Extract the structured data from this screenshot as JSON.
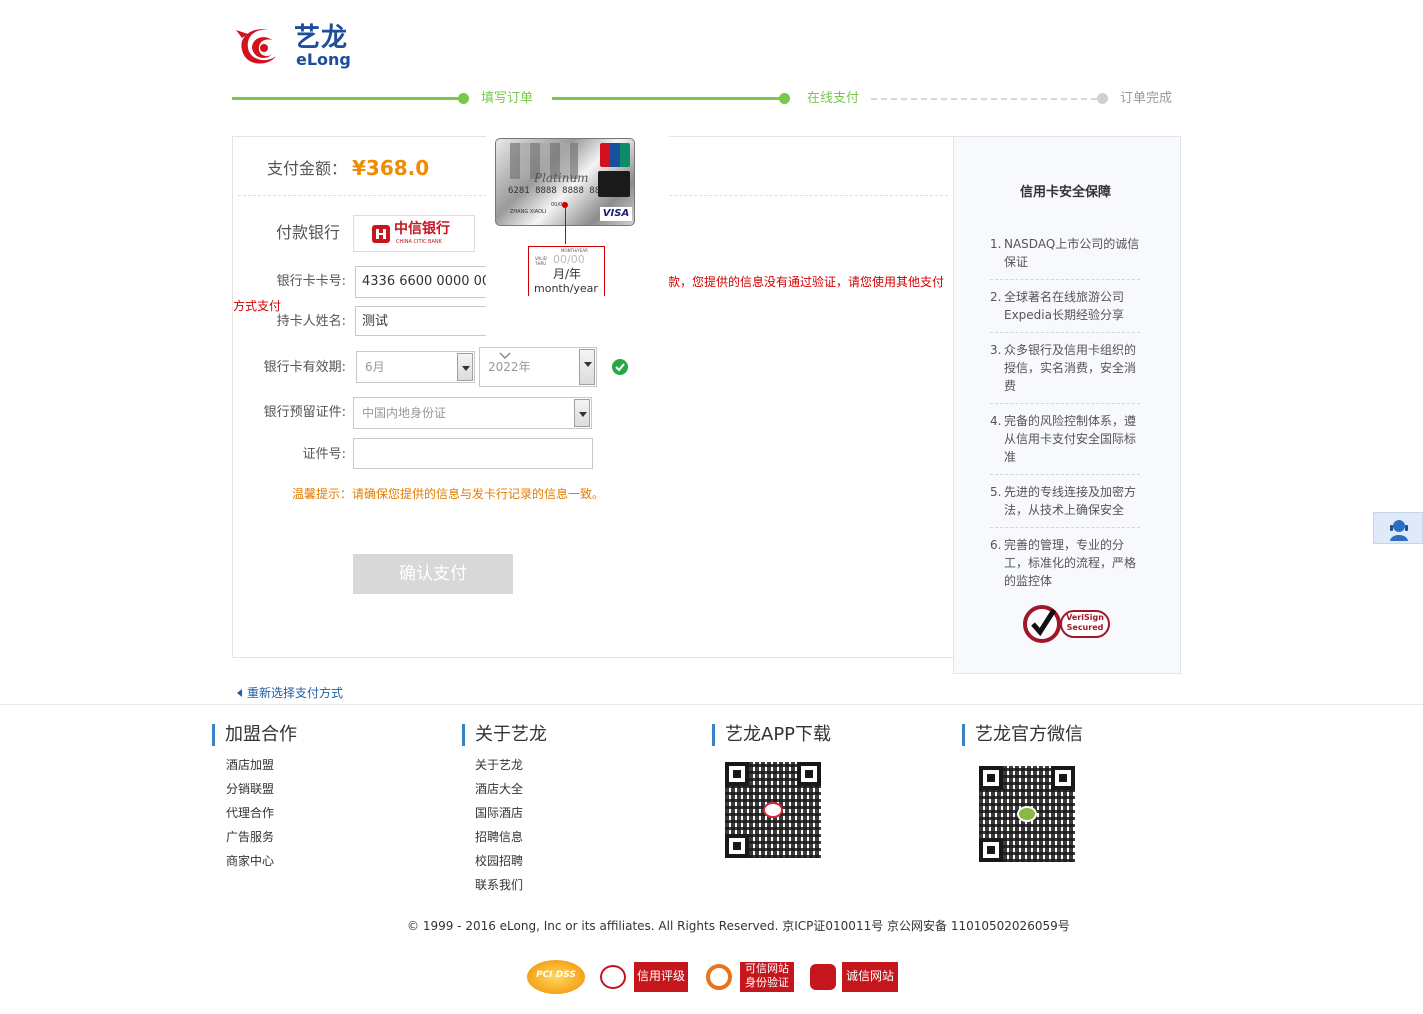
{
  "logo": {
    "cn": "艺龙",
    "en": "eLong"
  },
  "steps": [
    {
      "label": "填写订单",
      "state": "done"
    },
    {
      "label": "在线支付",
      "state": "current"
    },
    {
      "label": "订单完成",
      "state": "todo"
    }
  ],
  "payment": {
    "amount_label": "支付金额：",
    "amount": "¥368.0",
    "bank_label": "付款银行",
    "bank_name": "中信银行",
    "bank_name_en": "CHINA CITIC BANK",
    "card_no_label": "银行卡卡号:",
    "card_no_value": "4336 6600 0000 000",
    "error_text": "款，您提供的信息没有通过验证，请您使用其他支付",
    "error_text_wrap": "方式支付",
    "holder_label": "持卡人姓名:",
    "holder_value": "测试",
    "expiry_label": "银行卡有效期:",
    "month_value": "6月",
    "year_value": "2022年",
    "id_type_label": "银行预留证件:",
    "id_type_value": "中国内地身份证",
    "id_no_label": "证件号:",
    "id_no_value": "",
    "tip": "温馨提示：请确保您提供的信息与发卡行记录的信息一致。",
    "submit_label": "确认支付"
  },
  "card_tooltip": {
    "card_number": "6281 8888 8888 8888",
    "card_brand": "Platinum",
    "valid_thru": "00/00",
    "valid_caption": "VALID THRU",
    "month_year_header": "MONTH/YEAR",
    "month_year_cn": "月/年",
    "month_year_en": "month/year",
    "name": "ZHANG XIAOLI",
    "network": "VISA",
    "unionpay": "UnionPay 银联"
  },
  "security": {
    "title": "信用卡安全保障",
    "items": [
      "NASDAQ上市公司的诚信保证",
      "全球著名在线旅游公司Expedia长期经验分享",
      "众多银行及信用卡组织的授信，实名消费，安全消费",
      "完备的风险控制体系，遵从信用卡支付安全国际标准",
      "先进的专线连接及加密方法，从技术上确保安全",
      "完善的管理，专业的分工，标准化的流程，严格的监控体"
    ],
    "verisign_line1": "VeriSign",
    "verisign_line2": "Secured"
  },
  "back_link": "重新选择支付方式",
  "footer": {
    "columns": [
      {
        "title": "加盟合作",
        "links": [
          "酒店加盟",
          "分销联盟",
          "代理合作",
          "广告服务",
          "商家中心"
        ]
      },
      {
        "title": "关于艺龙",
        "links": [
          "关于艺龙",
          "酒店大全",
          "国际酒店",
          "招聘信息",
          "校园招聘",
          "联系我们"
        ]
      },
      {
        "title": "艺龙APP下载"
      },
      {
        "title": "艺龙官方微信"
      }
    ],
    "copyright": "© 1999 - 2016 eLong, Inc or its affiliates. All Rights Reserved. 京ICP证010011号 京公网安备 11010502026059号",
    "badges": [
      "PCI DSS",
      "信用评级",
      "可信网站",
      "身份验证",
      "诚信网站"
    ]
  },
  "colors": {
    "step_done": "#78c84a",
    "step_todo": "#cfcfcf",
    "amount": "#f08c00",
    "error": "#d10000",
    "tip": "#e27c00",
    "link": "#1f5fa6"
  }
}
